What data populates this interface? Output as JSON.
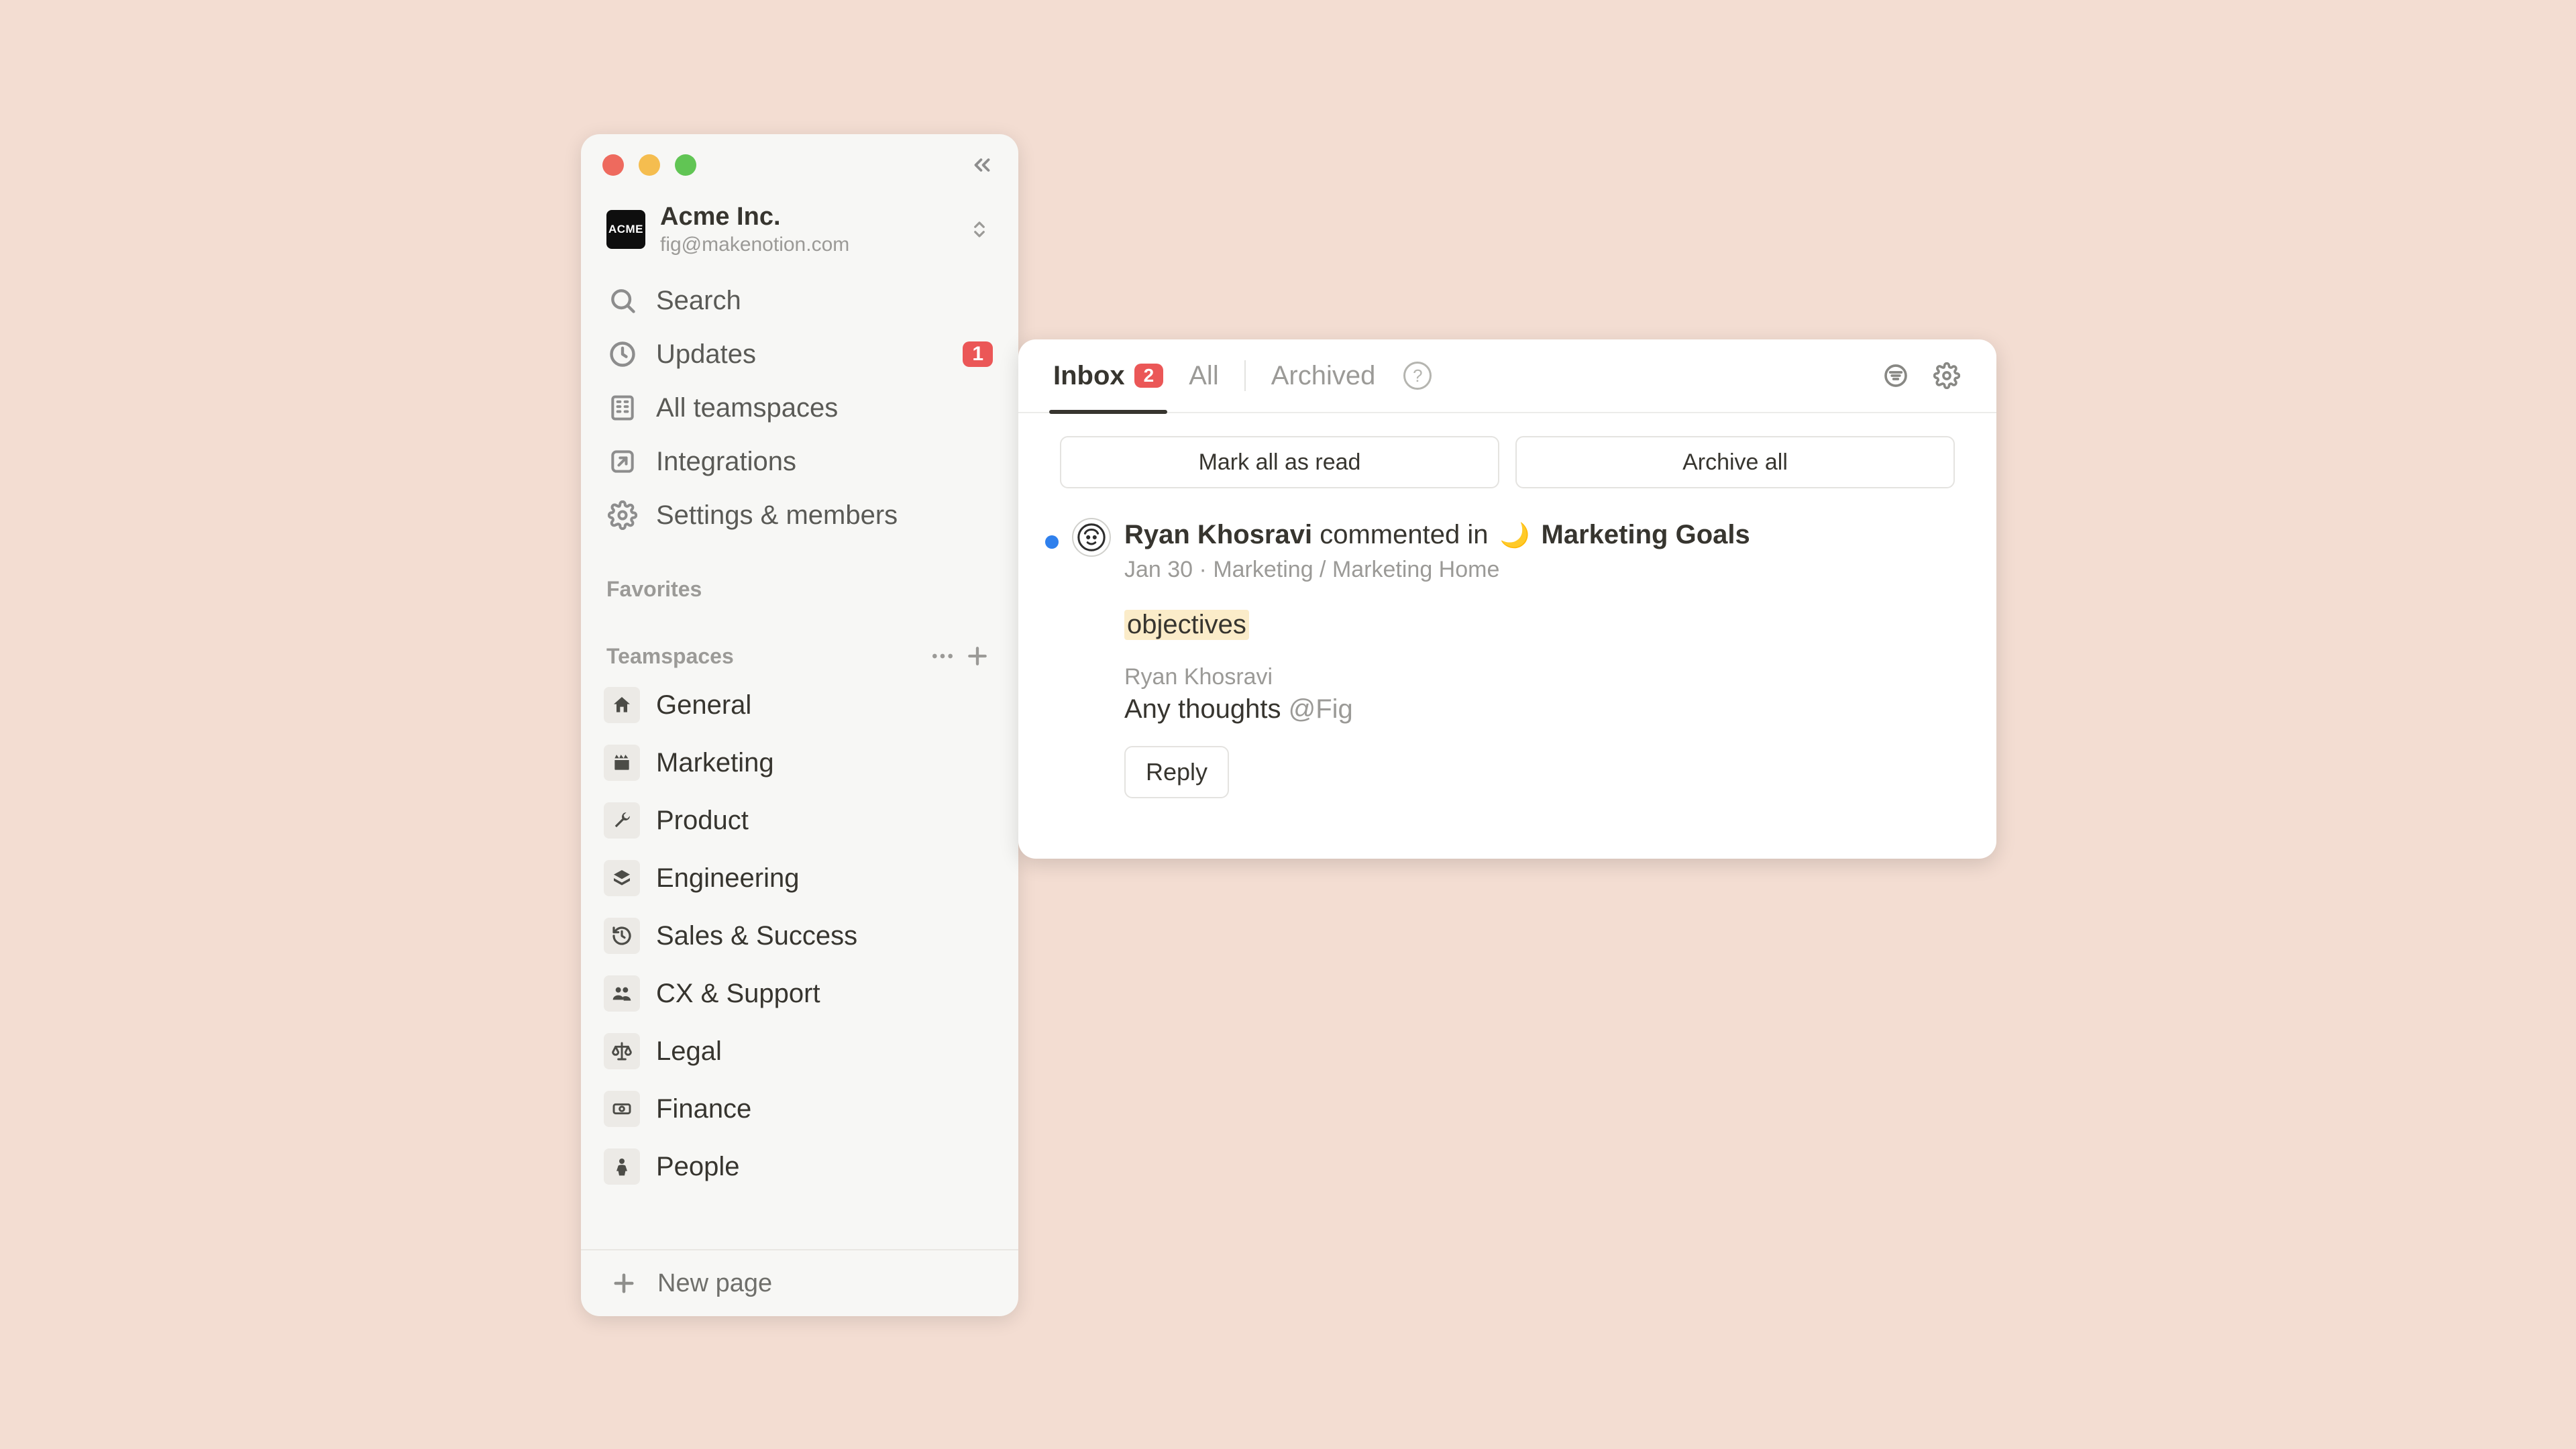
{
  "sidebar": {
    "workspace_name": "Acme Inc.",
    "workspace_email": "fig@makenotion.com",
    "workspace_logo_text": "ACME",
    "nav": {
      "search": "Search",
      "updates": "Updates",
      "updates_badge": "1",
      "all_teamspaces": "All teamspaces",
      "integrations": "Integrations",
      "settings": "Settings & members"
    },
    "favorites_label": "Favorites",
    "teamspaces_label": "Teamspaces",
    "teamspaces": [
      {
        "name": "General",
        "emoji": "🏠"
      },
      {
        "name": "Marketing",
        "emoji": "🎬"
      },
      {
        "name": "Product",
        "emoji": "🔧"
      },
      {
        "name": "Engineering",
        "emoji": ""
      },
      {
        "name": "Sales & Success",
        "emoji": ""
      },
      {
        "name": "CX & Support",
        "emoji": ""
      },
      {
        "name": "Legal",
        "emoji": ""
      },
      {
        "name": "Finance",
        "emoji": ""
      },
      {
        "name": "People",
        "emoji": ""
      }
    ],
    "new_page": "New page"
  },
  "inbox": {
    "tabs": {
      "inbox_label": "Inbox",
      "inbox_badge": "2",
      "all_label": "All",
      "archived_label": "Archived",
      "help": "?"
    },
    "bulk": {
      "mark_all_read": "Mark all as read",
      "archive_all": "Archive all"
    },
    "item": {
      "actor": "Ryan Khosravi",
      "action": "commented in",
      "page_emoji": "🌙",
      "page_name": "Marketing Goals",
      "date": "Jan 30",
      "breadcrumb": "Marketing / Marketing Home",
      "highlight": "objectives",
      "commenter": "Ryan Khosravi",
      "comment_text": "Any thoughts ",
      "comment_mention": "@Fig",
      "reply": "Reply"
    }
  }
}
